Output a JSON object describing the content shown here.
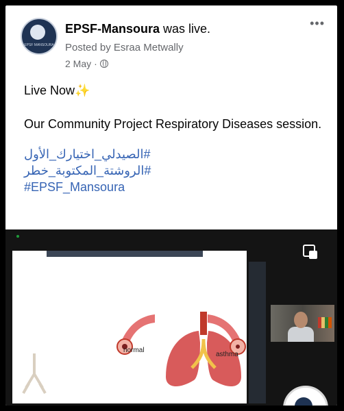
{
  "post": {
    "page_name": "EPSF-Mansoura",
    "action": " was live.",
    "posted_by": "Posted by Esraa Metwally",
    "date": "2 May",
    "date_sep": "·",
    "more_label": "•••"
  },
  "body": {
    "line1": "Live Now",
    "sparkle": "✨",
    "line2": "Our Community Project Respiratory Diseases session.",
    "hashtags": [
      "#الصيدلي_اختيارك_الأول",
      "#الروشتة_المكتوبة_خطر",
      "#EPSF_Mansoura"
    ]
  },
  "video": {
    "label_normal": "normal",
    "label_asthma": "asthma"
  },
  "colors": {
    "hashtag": "#3664b4",
    "meta": "#65676b",
    "video_bg": "#141414"
  },
  "icons": {
    "avatar": "epsf-logo",
    "globe": "globe-icon",
    "pip": "picture-in-picture-icon",
    "more": "more-icon"
  }
}
